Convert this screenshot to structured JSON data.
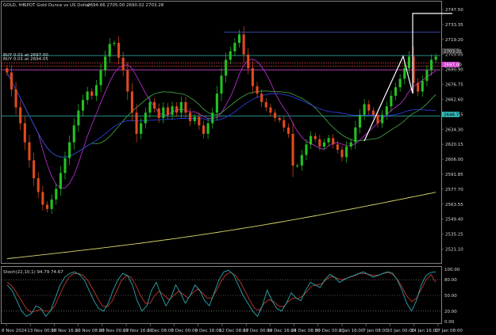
{
  "header": {
    "symbol": "GOLD, H4",
    "description": "SPOT Gold Ounce vs US Dollar",
    "ohlc": "2694.66 2705.00 2690.02 2703.28"
  },
  "order_labels": {
    "buy_1": "BUY 0.01 at 2697.00",
    "buy_2": "BUY 0.01 at 2694.05"
  },
  "price_tags": {
    "current": "2703.28",
    "ask_line": "2697.00",
    "cyan_line": "2646.75"
  },
  "indicator": {
    "label": "Stoch(22,10,1) 94.79 74.67",
    "levels": [
      "100.00",
      "80.00",
      "50.00",
      "20.00",
      "0.00"
    ]
  },
  "colors": {
    "background": "#000000",
    "bull_candle": "#22c322",
    "bear_candle": "#e04a1f",
    "ma_purple": "#b02bc8",
    "ma_green": "#3f9a3f",
    "ma_blue": "#2a3bd8",
    "ma_yellow": "#d8d86a",
    "stoch_main": "#2aa6b0",
    "stoch_signal": "#c0392b",
    "hline_blue": "#4a5fd8",
    "hline_cyan": "#33b6b6",
    "hline_magenta": "#cc44cc"
  },
  "chart_data": {
    "type": "candlestick",
    "timeframe": "H4",
    "y_axis_ticks": [
      "2747.50",
      "2733.35",
      "2719.20",
      "2705.05",
      "2690.90",
      "2676.75",
      "2662.60",
      "2648.45",
      "2634.30",
      "2620.15",
      "2606.00",
      "2591.85",
      "2577.70",
      "2563.55",
      "2549.40",
      "2535.25",
      "2521.10"
    ],
    "x_axis_labels": [
      "8 Nov 2024",
      "13 Nov 00:00",
      "15 Nov 16:00",
      "20 Nov 08:00",
      "25 Nov 00:00",
      "27 Nov 16:00",
      "2 Dec 08:00",
      "5 Dec 00:00",
      "9 Dec 16:00",
      "12 Dec 08:00",
      "17 Dec 00:00",
      "19 Dec 16:00",
      "24 Dec 08:00",
      "30 Dec 00:00",
      "2 Jan 16:00",
      "7 Jan 08:00",
      "10 Jan 00:00",
      "14 Jan 16:00",
      "17 Jan 08:00"
    ],
    "ylim": [
      2508,
      2755
    ],
    "horizontal_lines": [
      {
        "price": 2726.0,
        "color": "blue"
      },
      {
        "price": 2704.0,
        "color": "cyan"
      },
      {
        "price": 2697.0,
        "color": "red-dashed"
      },
      {
        "price": 2694.0,
        "color": "red-dashed"
      },
      {
        "price": 2690.5,
        "color": "magenta"
      },
      {
        "price": 2646.75,
        "color": "cyan"
      }
    ],
    "candles_close": [
      2688,
      2672,
      2655,
      2640,
      2622,
      2605,
      2588,
      2575,
      2563,
      2559,
      2568,
      2578,
      2593,
      2607,
      2622,
      2638,
      2652,
      2662,
      2670,
      2666,
      2676,
      2690,
      2703,
      2715,
      2716,
      2702,
      2690,
      2670,
      2650,
      2630,
      2640,
      2650,
      2660,
      2654,
      2645,
      2655,
      2648,
      2656,
      2650,
      2660,
      2650,
      2642,
      2646,
      2638,
      2630,
      2640,
      2650,
      2668,
      2685,
      2700,
      2708,
      2716,
      2724,
      2705,
      2692,
      2675,
      2668,
      2660,
      2655,
      2650,
      2645,
      2643,
      2636,
      2630,
      2600,
      2600,
      2610,
      2620,
      2628,
      2625,
      2618,
      2622,
      2626,
      2620,
      2615,
      2608,
      2618,
      2622,
      2636,
      2648,
      2658,
      2652,
      2648,
      2640,
      2648,
      2656,
      2666,
      2674,
      2682,
      2692,
      2703,
      2678,
      2670,
      2680,
      2690,
      2700,
      2703
    ],
    "stoch_main": [
      70,
      60,
      40,
      20,
      10,
      15,
      30,
      25,
      10,
      20,
      45,
      70,
      85,
      92,
      95,
      90,
      80,
      60,
      40,
      25,
      20,
      35,
      60,
      80,
      92,
      88,
      70,
      40,
      20,
      30,
      60,
      75,
      50,
      30,
      45,
      70,
      55,
      35,
      50,
      70,
      60,
      40,
      30,
      55,
      80,
      95,
      98,
      90,
      70,
      50,
      35,
      20,
      10,
      30,
      60,
      40,
      25,
      20,
      35,
      55,
      45,
      40,
      60,
      75,
      70,
      65,
      80,
      90,
      85,
      75,
      80,
      85,
      88,
      92,
      95,
      90,
      85,
      88,
      92,
      95,
      93,
      80,
      60,
      35,
      20,
      40,
      70,
      88,
      94,
      95
    ],
    "stoch_signal": [
      75,
      68,
      55,
      40,
      25,
      18,
      20,
      23,
      20,
      20,
      30,
      50,
      70,
      85,
      92,
      92,
      88,
      78,
      62,
      45,
      30,
      28,
      38,
      58,
      78,
      88,
      85,
      70,
      50,
      35,
      35,
      50,
      58,
      50,
      42,
      50,
      58,
      52,
      45,
      55,
      62,
      55,
      45,
      45,
      60,
      78,
      90,
      94,
      88,
      75,
      58,
      40,
      25,
      22,
      35,
      42,
      38,
      30,
      28,
      38,
      45,
      44,
      48,
      58,
      68,
      70,
      72,
      80,
      86,
      84,
      80,
      82,
      85,
      88,
      92,
      92,
      90,
      88,
      89,
      92,
      94,
      90,
      80,
      65,
      48,
      38,
      45,
      62,
      80,
      90,
      74.67
    ]
  }
}
